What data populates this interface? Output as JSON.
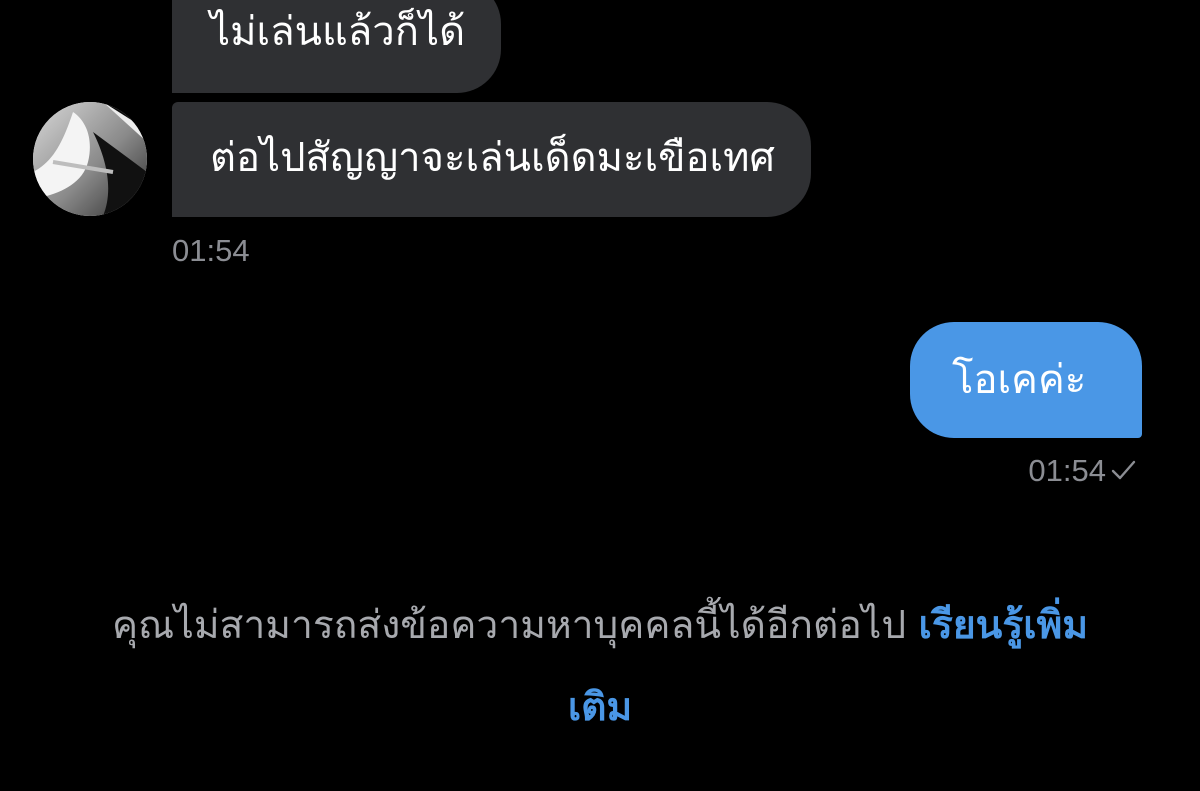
{
  "messages": {
    "incoming": [
      {
        "text": "ไม่เล่นแล้วก็ได้"
      },
      {
        "text": "ต่อไปสัญญาจะเล่นเด็ดมะเขือเทศ"
      }
    ],
    "incoming_time": "01:54",
    "outgoing": [
      {
        "text": "โอเคค่ะ"
      }
    ],
    "outgoing_time": "01:54",
    "outgoing_status_icon": "check-icon"
  },
  "notice": {
    "text": "คุณไม่สามารถส่งข้อความหาบุคคลนี้ได้อีกต่อไป",
    "link_line_1": "เรียนรู้เพิ่ม",
    "link_line_2": "เติม"
  },
  "colors": {
    "background": "#000000",
    "incoming_bubble": "#2f3033",
    "outgoing_bubble": "#4a97e6",
    "timestamp": "#8b8d93",
    "notice_text": "#a7a9ae",
    "link": "#4a97e6"
  }
}
